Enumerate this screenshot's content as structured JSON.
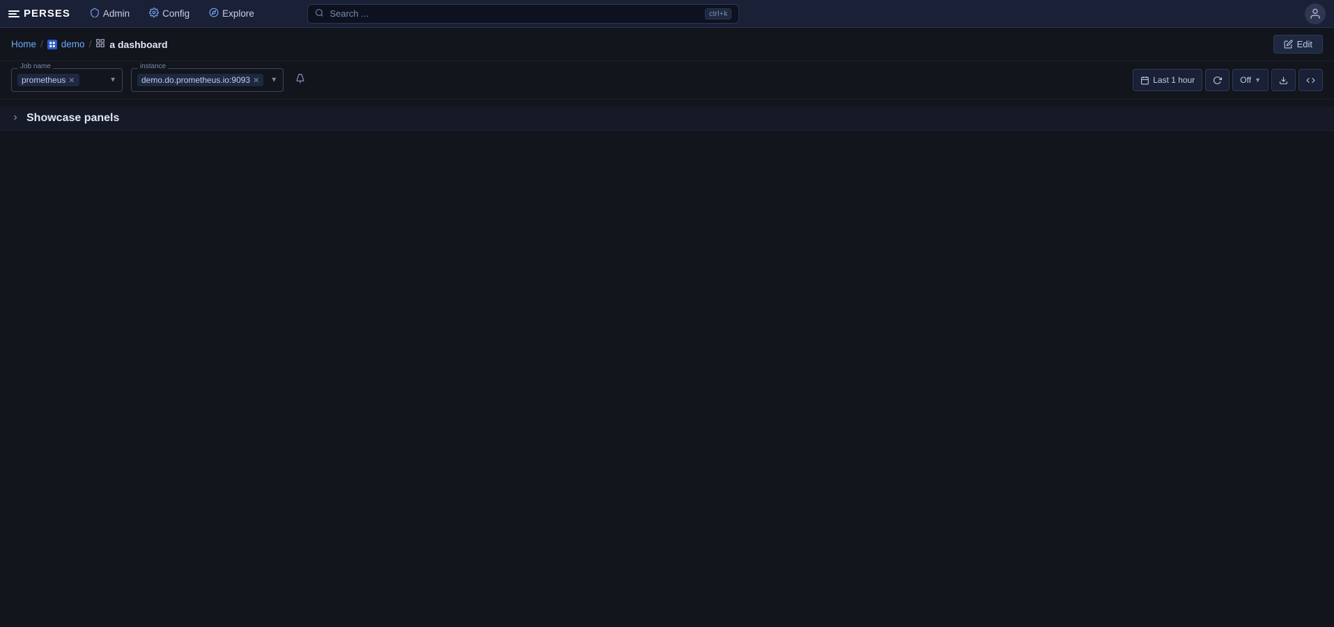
{
  "app": {
    "brand": "PERSES",
    "brand_icon": "menu-icon"
  },
  "topnav": {
    "items": [
      {
        "id": "admin",
        "label": "Admin",
        "icon": "shield-icon"
      },
      {
        "id": "config",
        "label": "Config",
        "icon": "gear-icon"
      },
      {
        "id": "explore",
        "label": "Explore",
        "icon": "compass-icon"
      }
    ],
    "search_placeholder": "Search ...",
    "search_shortcut": "ctrl+k"
  },
  "breadcrumb": {
    "home_label": "Home",
    "sep1": "/",
    "demo_label": "demo",
    "sep2": "/",
    "current_label": "a dashboard"
  },
  "edit_button_label": "Edit",
  "filters": {
    "job_name_label": "Job name",
    "job_name_value": "prometheus",
    "instance_label": "instance",
    "instance_value": "demo.do.prometheus.io:9093"
  },
  "time_controls": {
    "time_range_label": "Last 1 hour",
    "refresh_label": "Off"
  },
  "section": {
    "title": "Showcase panels",
    "collapsed": false
  }
}
